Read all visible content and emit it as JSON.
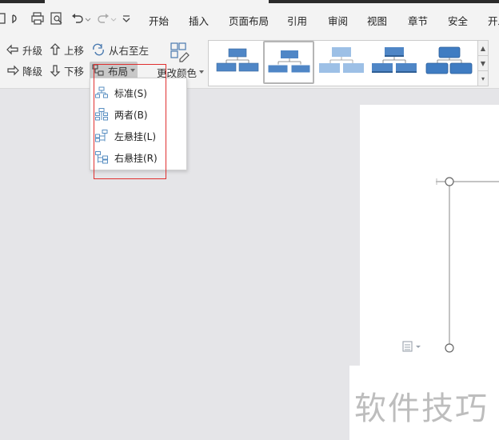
{
  "menu": {
    "tabs": [
      "开始",
      "插入",
      "页面布局",
      "引用",
      "审阅",
      "视图",
      "章节",
      "安全",
      "开发"
    ]
  },
  "ribbon": {
    "promote_label": "升级",
    "demote_label": "降级",
    "move_up_label": "上移",
    "move_down_label": "下移",
    "right_to_left_label": "从右至左",
    "layout_label": "布局",
    "change_colors_label": "更改颜色"
  },
  "layout_menu": {
    "items": [
      {
        "label": "标准(S)",
        "icon": "standard-layout-icon"
      },
      {
        "label": "两者(B)",
        "icon": "both-layout-icon"
      },
      {
        "label": "左悬挂(L)",
        "icon": "left-hanging-layout-icon"
      },
      {
        "label": "右悬挂(R)",
        "icon": "right-hanging-layout-icon"
      }
    ]
  },
  "watermark": "软件技巧",
  "colors": {
    "accent": "#5b9bd5",
    "highlight": "#e03030"
  }
}
